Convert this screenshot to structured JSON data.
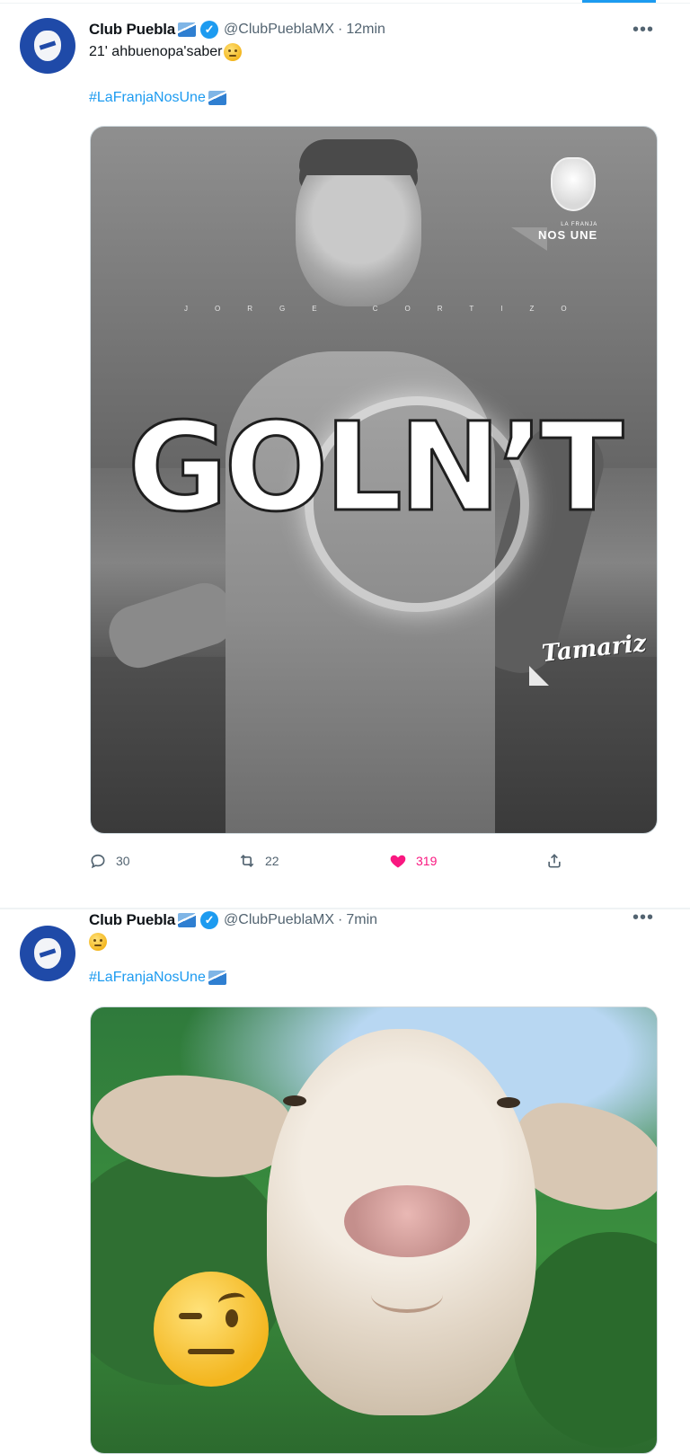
{
  "tweets": [
    {
      "author_name": "Club Puebla",
      "handle": "@ClubPueblaMX",
      "separator": "·",
      "time": "12min",
      "text": "21' ahbuenopa'saber",
      "hashtag": "#LaFranjaNosUne",
      "media": {
        "headline": "GOLN’T",
        "player_name": "JORGE CORTIZO",
        "crest_motto_small": "LA FRANJA",
        "crest_motto": "NOS UNE",
        "sponsor": "Tamariz"
      },
      "actions": {
        "replies": "30",
        "retweets": "22",
        "likes": "319"
      }
    },
    {
      "author_name": "Club Puebla",
      "handle": "@ClubPueblaMX",
      "separator": "·",
      "time": "7min",
      "text": "",
      "hashtag": "#LaFranjaNosUne"
    }
  ],
  "icons": {
    "more": "more-horizontal-icon",
    "reply": "reply-icon",
    "retweet": "retweet-icon",
    "like": "heart-icon",
    "share": "share-icon",
    "verified": "verified-badge-icon"
  },
  "colors": {
    "accent": "#1d9bf0",
    "like": "#f91880",
    "muted": "#536471",
    "text": "#0f1419"
  },
  "state": {
    "tweet1_liked": true
  }
}
